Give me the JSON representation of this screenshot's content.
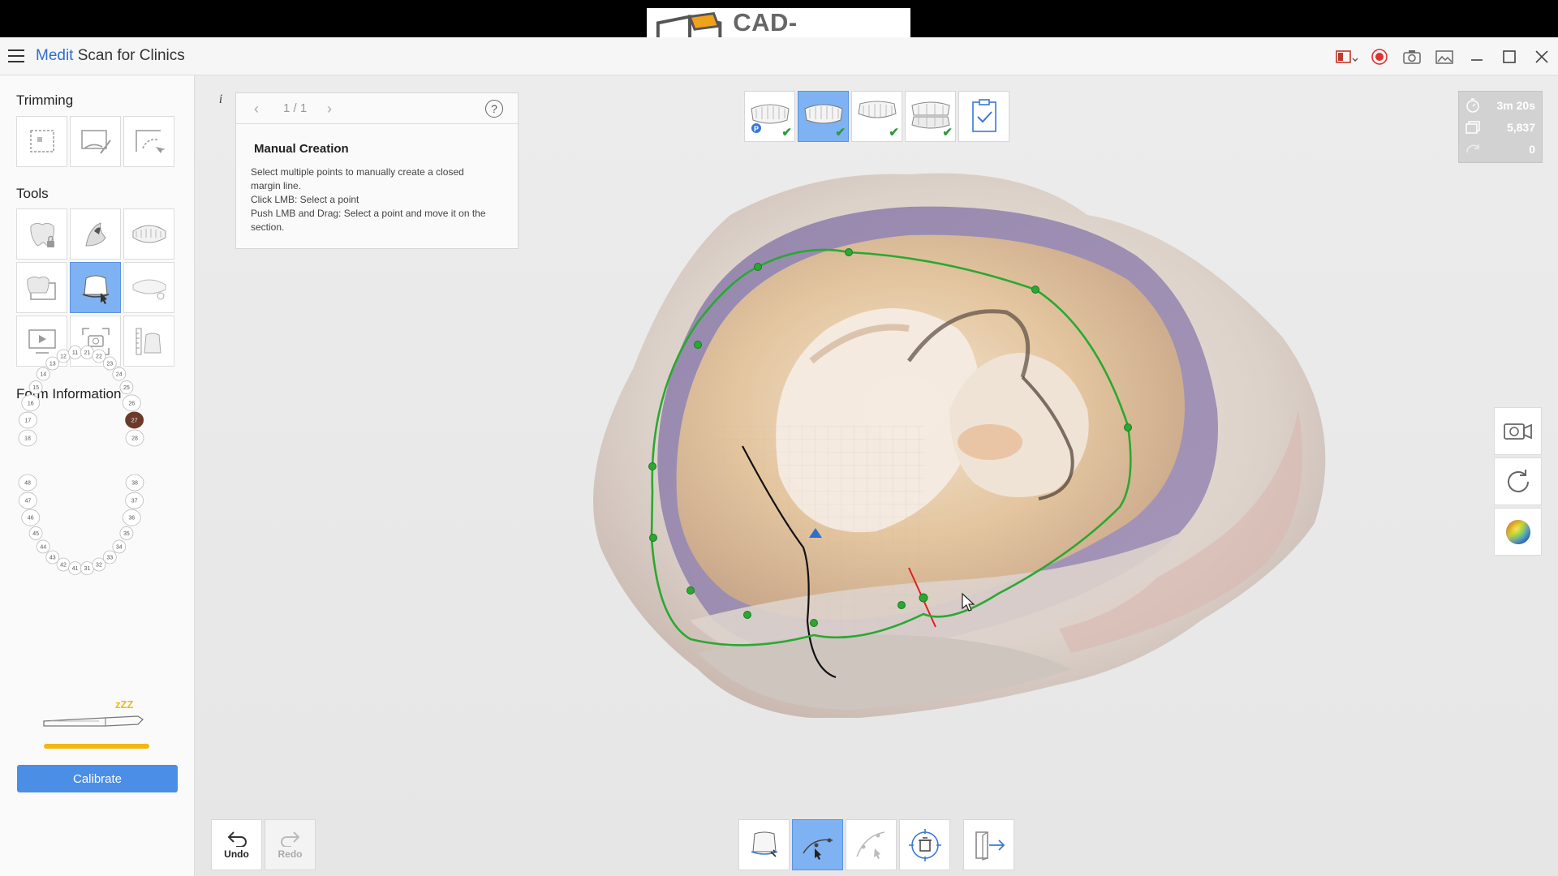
{
  "watermark": {
    "text": "CAD-RAY.COM"
  },
  "titlebar": {
    "app_brand": "Medit",
    "app_name": " Scan for Clinics",
    "icons": [
      "layout-icon",
      "record-icon",
      "camera-icon",
      "image-icon",
      "minimize-icon",
      "maximize-icon",
      "close-icon"
    ]
  },
  "left_panel": {
    "trimming_title": "Trimming",
    "tools_title": "Tools",
    "form_info_title": "Form Information",
    "calibrate_label": "Calibrate",
    "calibration_progress": 1.0,
    "accent_color": "#4a8ee6",
    "progress_color": "#f2b712",
    "sleep_label": "zZZ"
  },
  "tooth_chart": {
    "upper": [
      "18",
      "17",
      "16",
      "15",
      "14",
      "13",
      "12",
      "11",
      "21",
      "22",
      "23",
      "24",
      "25",
      "26",
      "27",
      "28"
    ],
    "lower": [
      "48",
      "47",
      "46",
      "45",
      "44",
      "43",
      "42",
      "41",
      "31",
      "32",
      "33",
      "34",
      "35",
      "36",
      "37",
      "38"
    ],
    "selected": "27",
    "selected_color": "#6b3a2a"
  },
  "guide": {
    "page": "1 / 1",
    "help": "?",
    "info": "i",
    "title": "Manual Creation",
    "lines": [
      "Select multiple points to manually create a closed",
      "margin line.",
      "Click LMB: Select a point",
      "Push LMB and Drag: Select a point and move it on the",
      "section."
    ]
  },
  "stages": [
    {
      "name": "stage-maxilla-prep",
      "done": true,
      "active": false
    },
    {
      "name": "stage-maxilla",
      "done": true,
      "active": true
    },
    {
      "name": "stage-mandible",
      "done": true,
      "active": false
    },
    {
      "name": "stage-occlusion",
      "done": true,
      "active": false
    },
    {
      "name": "stage-review",
      "done": false,
      "active": false
    }
  ],
  "stats": {
    "time": "3m 20s",
    "count": "5,837",
    "rotations": "0"
  },
  "bottom": {
    "undo_label": "Undo",
    "redo_label": "Redo"
  },
  "margin_line_color": "#2aa832",
  "active_color": "#7fb2f2"
}
